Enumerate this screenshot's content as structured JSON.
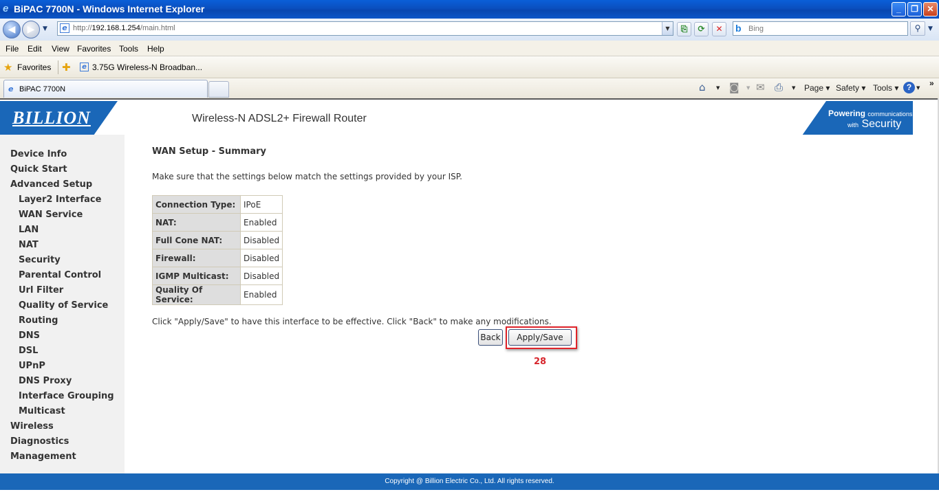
{
  "window": {
    "title": "BiPAC 7700N - Windows Internet Explorer",
    "buttons": {
      "minimize": "_",
      "maximize": "❐",
      "close": "✕"
    }
  },
  "address_bar": {
    "url_prefix": "http://",
    "url_host": "192.168.1.254",
    "url_path": "/main.html",
    "search_placeholder": "Bing",
    "search_logo": "b"
  },
  "menu": [
    "File",
    "Edit",
    "View",
    "Favorites",
    "Tools",
    "Help"
  ],
  "favorites_bar": {
    "label": "Favorites",
    "link": "3.75G Wireless-N Broadban..."
  },
  "tabs": {
    "active_label": "BiPAC 7700N"
  },
  "command_bar": {
    "page": "Page",
    "safety": "Safety",
    "tools": "Tools",
    "help": "?"
  },
  "router": {
    "logo": "BILLION",
    "header_title": "Wireless-N ADSL2+ Firewall Router",
    "brand_line1_bold": "Powering",
    "brand_line1_small": "communications",
    "brand_line2_small": "with",
    "brand_line2": "Security"
  },
  "sidebar": {
    "items": [
      {
        "label": "Device Info",
        "level": 0
      },
      {
        "label": "Quick Start",
        "level": 0
      },
      {
        "label": "Advanced Setup",
        "level": 0
      },
      {
        "label": "Layer2 Interface",
        "level": 1
      },
      {
        "label": "WAN Service",
        "level": 1
      },
      {
        "label": "LAN",
        "level": 1
      },
      {
        "label": "NAT",
        "level": 1
      },
      {
        "label": "Security",
        "level": 1
      },
      {
        "label": "Parental Control",
        "level": 1
      },
      {
        "label": "Url Filter",
        "level": 1
      },
      {
        "label": "Quality of Service",
        "level": 1
      },
      {
        "label": "Routing",
        "level": 1
      },
      {
        "label": "DNS",
        "level": 1
      },
      {
        "label": "DSL",
        "level": 1
      },
      {
        "label": "UPnP",
        "level": 1
      },
      {
        "label": "DNS Proxy",
        "level": 1
      },
      {
        "label": "Interface Grouping",
        "level": 1
      },
      {
        "label": "Multicast",
        "level": 1
      },
      {
        "label": "Wireless",
        "level": 0
      },
      {
        "label": "Diagnostics",
        "level": 0
      },
      {
        "label": "Management",
        "level": 0
      }
    ]
  },
  "main": {
    "heading": "WAN Setup - Summary",
    "intro": "Make sure that the settings below match the settings provided by your ISP.",
    "summary_rows": [
      {
        "key": "Connection Type:",
        "value": "IPoE"
      },
      {
        "key": "NAT:",
        "value": "Enabled"
      },
      {
        "key": "Full Cone NAT:",
        "value": "Disabled"
      },
      {
        "key": "Firewall:",
        "value": "Disabled"
      },
      {
        "key": "IGMP Multicast:",
        "value": "Disabled"
      },
      {
        "key": "Quality Of Service:",
        "value": "Enabled"
      }
    ],
    "note": "Click \"Apply/Save\" to have this interface to be effective. Click \"Back\" to make any modifications.",
    "back_label": "Back",
    "apply_label": "Apply/Save",
    "step_number": "28"
  },
  "footer": {
    "copyright": "Copyright @ Billion Electric Co., Ltd. All rights reserved."
  },
  "colors": {
    "brand_blue": "#1a67b8",
    "highlight_red": "#e0232a",
    "sidebar_bg": "#f1f1f1"
  }
}
